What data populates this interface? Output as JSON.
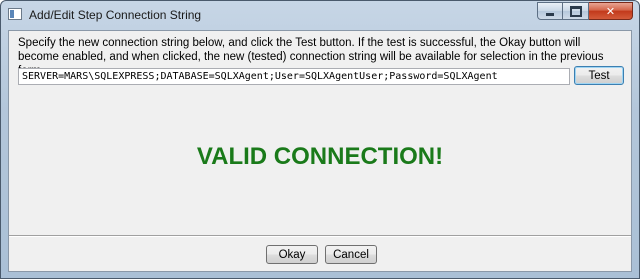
{
  "window": {
    "title": "Add/Edit Step Connection String",
    "app_icon": "window-icon",
    "caption_icons": [
      "minimize-icon",
      "maximize-icon",
      "close-icon"
    ],
    "close_glyph": "✕"
  },
  "form": {
    "instructions": "Specify the new connection string below, and click the Test button.  If the test is successful, the Okay button will become enabled, and when clicked, the new (tested) connection string will be available for selection in the previous form.",
    "connection_string": "SERVER=MARS\\SQLEXPRESS;DATABASE=SQLXAgent;User=SQLXAgentUser;Password=SQLXAgent",
    "test_label": "Test",
    "status_text": "VALID CONNECTION!",
    "status_color": "#1a7a1a"
  },
  "footer": {
    "okay_label": "Okay",
    "cancel_label": "Cancel"
  }
}
